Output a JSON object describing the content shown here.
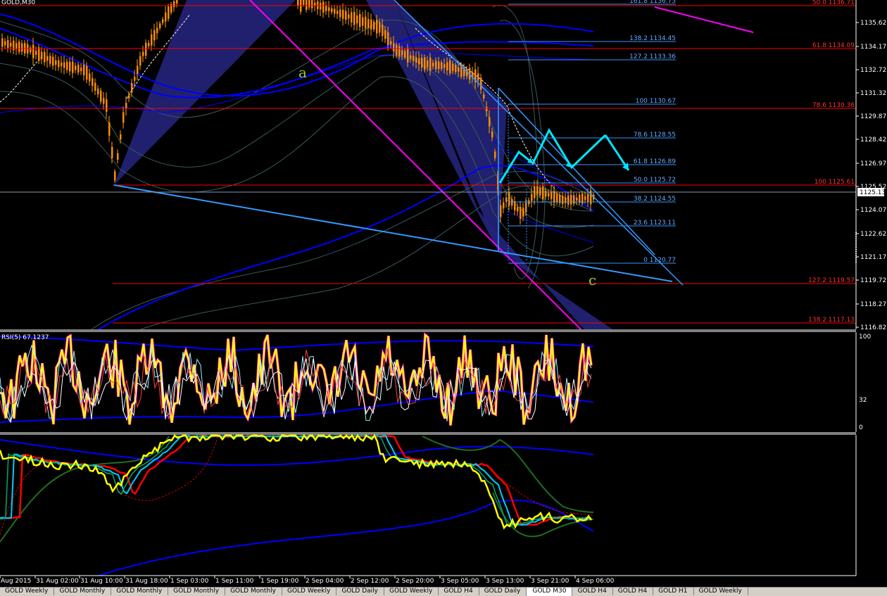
{
  "window": {
    "title": "GOLD,M30"
  },
  "colors": {
    "background": "#000000",
    "grid": "#ffffff",
    "fib_red": "#ff0000",
    "fib_blue": "#3399ff",
    "pattern_fill": "#23237a",
    "magenta_line": "#ff00ff",
    "cyan_projection": "#00e5ff",
    "candle": "#ff8c00",
    "rsi_main": "#ffff00",
    "ma_red": "#ff0000",
    "ma_cyan": "#00ccff",
    "band_blue": "#0000ff",
    "band_green": "#1f6e1f"
  },
  "price_axis": {
    "ticks": [
      "1135.62",
      "1134.17",
      "1132.72",
      "1131.32",
      "1129.87",
      "1128.42",
      "1126.97",
      "1125.52",
      "1124.07",
      "1122.62",
      "1121.17",
      "1119.72",
      "1118.27",
      "1116.82"
    ],
    "current_price": "1125.13"
  },
  "fib_red_levels": [
    {
      "label": "50.0 1136.71"
    },
    {
      "label": "61.8 1134.09"
    },
    {
      "label": "78.6 1130.36"
    },
    {
      "label": "100 1125.61"
    },
    {
      "label": "127.2 1119.57"
    },
    {
      "label": "138.2 1117.13"
    }
  ],
  "fib_blue_levels": [
    {
      "label": "161.8 1136.75"
    },
    {
      "label": "138.2 1134.45"
    },
    {
      "label": "127.2 1133.36"
    },
    {
      "label": "100 1130.67"
    },
    {
      "label": "78.6 1128.55"
    },
    {
      "label": "61.8 1126.89"
    },
    {
      "label": "50.0 1125.72"
    },
    {
      "label": "38.2 1124.55"
    },
    {
      "label": "23.6 1123.11"
    },
    {
      "label": "0 1120.77"
    }
  ],
  "wave_labels": {
    "a": "a",
    "c": "c"
  },
  "rsi_panel": {
    "title": "RSI(5) 67.1237",
    "ticks": [
      "100",
      "32",
      "0"
    ]
  },
  "time_axis": {
    "labels": [
      "Aug 2015",
      "31 Aug 02:00",
      "31 Aug 10:00",
      "31 Aug 18:00",
      "1 Sep 03:00",
      "1 Sep 11:00",
      "1 Sep 19:00",
      "2 Sep 04:00",
      "2 Sep 12:00",
      "2 Sep 20:00",
      "3 Sep 05:00",
      "3 Sep 13:00",
      "3 Sep 21:00",
      "4 Sep 06:00"
    ]
  },
  "tabs": [
    {
      "label": "GOLD Weekly",
      "active": false
    },
    {
      "label": "GOLD Monthly",
      "active": false
    },
    {
      "label": "GOLD Monthly",
      "active": false
    },
    {
      "label": "GOLD Monthly",
      "active": false
    },
    {
      "label": "GOLD Monthly",
      "active": false
    },
    {
      "label": "GOLD Weekly",
      "active": false
    },
    {
      "label": "GOLD Daily",
      "active": false
    },
    {
      "label": "GOLD Weekly",
      "active": false
    },
    {
      "label": "GOLD H4",
      "active": false
    },
    {
      "label": "GOLD Daily",
      "active": false
    },
    {
      "label": "GOLD M30",
      "active": true
    },
    {
      "label": "GOLD H4",
      "active": false
    },
    {
      "label": "GOLD H4",
      "active": false
    },
    {
      "label": "GOLD H1",
      "active": false
    },
    {
      "label": "GOLD Weekly",
      "active": false
    }
  ]
}
